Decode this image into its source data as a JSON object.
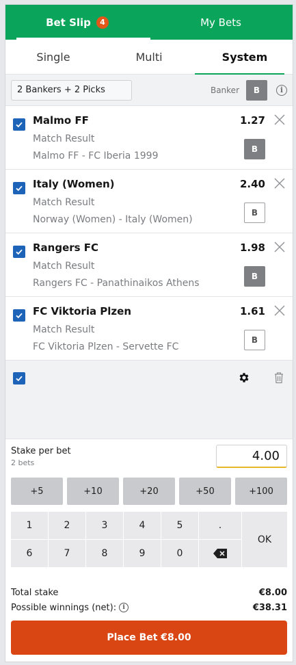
{
  "header": {
    "tabs": [
      {
        "label": "Bet Slip",
        "badge": "4"
      },
      {
        "label": "My Bets"
      }
    ]
  },
  "modes": [
    "Single",
    "Multi",
    "System"
  ],
  "system": {
    "selection": "2 Bankers + 2 Picks",
    "banker_label": "Banker",
    "banker_btn": "B"
  },
  "bets": [
    {
      "team": "Malmo FF",
      "market": "Match Result",
      "event": "Malmo FF - FC Iberia 1999",
      "odds": "1.27",
      "banker": "B",
      "banker_active": true
    },
    {
      "team": "Italy (Women)",
      "market": "Match Result",
      "event": "Norway (Women) - Italy (Women)",
      "odds": "2.40",
      "banker": "B",
      "banker_active": false
    },
    {
      "team": "Rangers FC",
      "market": "Match Result",
      "event": "Rangers FC - Panathinaikos Athens",
      "odds": "1.98",
      "banker": "B",
      "banker_active": true
    },
    {
      "team": "FC Viktoria Plzen",
      "market": "Match Result",
      "event": "FC Viktoria Plzen - Servette FC",
      "odds": "1.61",
      "banker": "B",
      "banker_active": false
    }
  ],
  "stake": {
    "label": "Stake per bet",
    "sub": "2 bets",
    "value": "4.00"
  },
  "quick_add": [
    "+5",
    "+10",
    "+20",
    "+50",
    "+100"
  ],
  "keypad": [
    "1",
    "2",
    "3",
    "4",
    "5",
    ".",
    "6",
    "7",
    "8",
    "9",
    "0"
  ],
  "ok_label": "OK",
  "totals": {
    "stake_label": "Total stake",
    "stake_value": "€8.00",
    "winnings_label": "Possible winnings (net):",
    "winnings_value": "€38.31"
  },
  "place_bet": "Place Bet €8.00",
  "colors": {
    "brand_green": "#0aa45a",
    "badge": "#e3561a",
    "checkbox": "#1d63b8",
    "cta": "#d94613",
    "input_accent": "#e5b82a"
  }
}
